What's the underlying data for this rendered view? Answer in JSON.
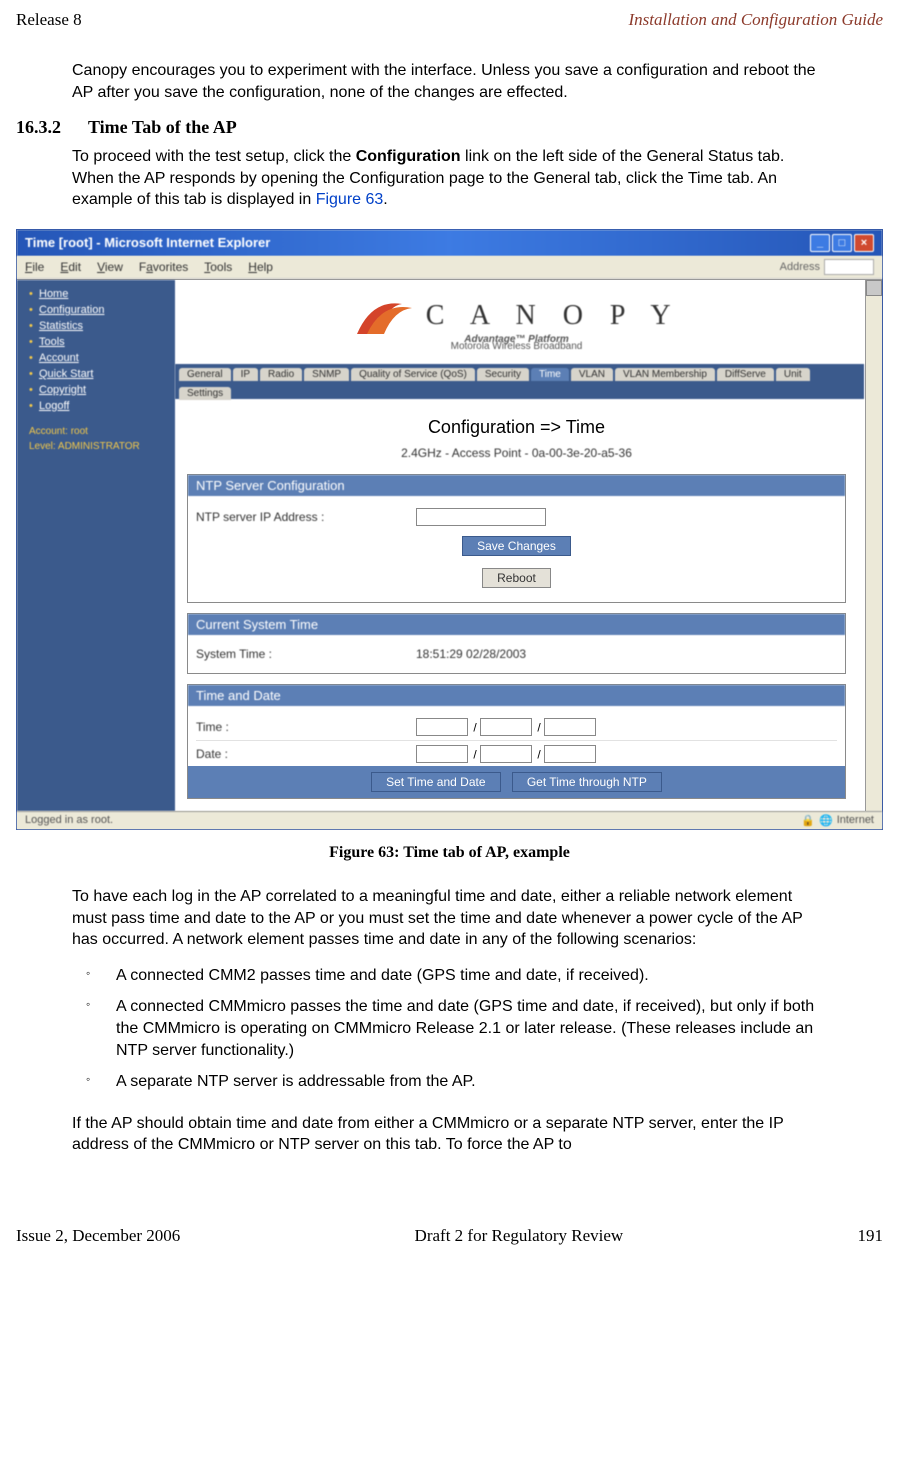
{
  "header": {
    "left": "Release 8",
    "right": "Installation and Configuration Guide"
  },
  "footer": {
    "left": "Issue 2, December 2006",
    "center": "Draft 2 for Regulatory Review",
    "right": "191"
  },
  "para1": "Canopy encourages you to experiment with the interface. Unless you save a configuration and reboot the AP after you save the configuration, none of the changes are effected.",
  "section": {
    "num": "16.3.2",
    "title": "Time Tab of the AP"
  },
  "para2_a": "To proceed with the test setup, click the ",
  "para2_b": "Configuration",
  "para2_c": " link on the left side of the General Status tab. When the AP responds by opening the Configuration page to the General tab, click the Time tab. An example of this tab is displayed in ",
  "para2_link": "Figure 63",
  "para2_d": ".",
  "caption": "Figure 63: Time tab of AP, example",
  "para3": "To have each log in the AP correlated to a meaningful time and date, either a reliable network element must pass time and date to the AP or you must set the time and date whenever a power cycle of the AP has occurred. A network element passes time and date in any of the following scenarios:",
  "bullets": [
    "A connected CMM2 passes time and date (GPS time and date, if received).",
    "A connected CMMmicro passes the time and date (GPS time and date, if received), but only if both the CMMmicro is operating on CMMmicro Release 2.1 or later release. (These releases include an NTP server functionality.)",
    "A separate NTP server is addressable from the AP."
  ],
  "para4": "If the AP should obtain time and date from either a CMMmicro or a separate NTP server, enter the IP address of the CMMmicro or NTP server on this tab. To force the AP to",
  "ie": {
    "title": "Time [root] - Microsoft Internet Explorer",
    "menu": {
      "file": "File",
      "edit": "Edit",
      "view": "View",
      "favorites": "Favorites",
      "tools": "Tools",
      "help": "Help",
      "address": "Address"
    },
    "logo": {
      "main": "C A N O P Y",
      "sub1": "Advantage™ Platform",
      "sub2": "Motorola Wireless Broadband"
    },
    "nav": [
      "Home",
      "Configuration",
      "Statistics",
      "Tools",
      "Account",
      "Quick Start",
      "Copyright",
      "Logoff"
    ],
    "acct": {
      "line1": "Account: root",
      "line2": "Level: ADMINISTRATOR"
    },
    "tabs": [
      "General",
      "IP",
      "Radio",
      "SNMP",
      "Quality of Service (QoS)",
      "Security",
      "Time",
      "VLAN",
      "VLAN Membership",
      "DiffServe",
      "Unit"
    ],
    "tabs2": "Settings",
    "page_title": "Configuration => Time",
    "device": "2.4GHz - Access Point - 0a-00-3e-20-a5-36",
    "panel1": {
      "h": "NTP Server Configuration",
      "lbl": "NTP server IP Address :"
    },
    "save": "Save Changes",
    "reboot": "Reboot",
    "panel2": {
      "h": "Current System Time",
      "lbl": "System Time :",
      "val": "18:51:29 02/28/2003"
    },
    "panel3": {
      "h": "Time and Date",
      "lbl1": "Time :",
      "lbl2": "Date :"
    },
    "btn_set": "Set Time and Date",
    "btn_get": "Get Time through NTP",
    "status_left": "Logged in as root.",
    "status_zone": "Internet"
  }
}
